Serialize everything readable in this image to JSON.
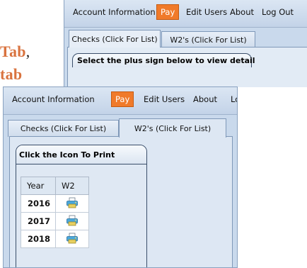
{
  "background_text": {
    "line1_bold": "Tab",
    "line1_tail": ",",
    "line2": "tab"
  },
  "panel_top": {
    "menu": {
      "account": "Account Information",
      "pay": "Pay",
      "edit_users": "Edit Users",
      "about": "About",
      "logout": "Log Out"
    },
    "tabs": {
      "checks": "Checks  (Click For List)",
      "w2": "W2's  (Click For List)"
    },
    "groupbox_title": "Select the plus sign below to view detail"
  },
  "panel_main": {
    "menu": {
      "account": "Account Information",
      "pay": "Pay",
      "edit_users": "Edit Users",
      "about": "About",
      "logout": "Log Out"
    },
    "tabs": {
      "checks": "Checks  (Click For List)",
      "w2": "W2's  (Click For List)"
    },
    "print_box_title": "Click the Icon To Print",
    "table": {
      "headers": [
        "Year",
        "W2"
      ],
      "rows": [
        {
          "year": "2016",
          "icon": "printer-icon"
        },
        {
          "year": "2017",
          "icon": "printer-icon"
        },
        {
          "year": "2018",
          "icon": "printer-icon"
        }
      ]
    }
  },
  "colors": {
    "active_menu": "#f07a2a",
    "accent_text": "#d9733f",
    "panel_bg": "#c9d9ec"
  }
}
